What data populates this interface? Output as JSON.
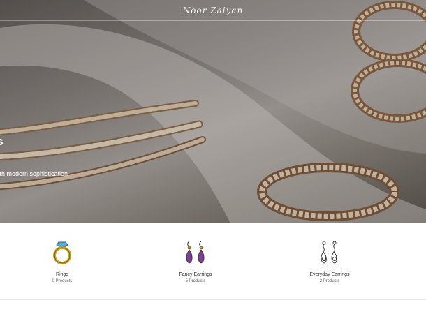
{
  "header": {
    "logo_text": "Noor Zaiyan"
  },
  "hero": {
    "title": "ets",
    "subtitle": "t with modern sophistication"
  },
  "categories": [
    {
      "name": "Rings",
      "count": "0 Products",
      "icon": "ring-icon"
    },
    {
      "name": "Fancy Earrings",
      "count": "5 Products",
      "icon": "fancy-earrings-icon"
    },
    {
      "name": "Everyday Earrings",
      "count": "2 Products",
      "icon": "everyday-earrings-icon"
    }
  ],
  "colors": {
    "gem_purple": "#7a3f8f",
    "gold": "#c9a227",
    "ring_blue": "#5aa9d6"
  }
}
